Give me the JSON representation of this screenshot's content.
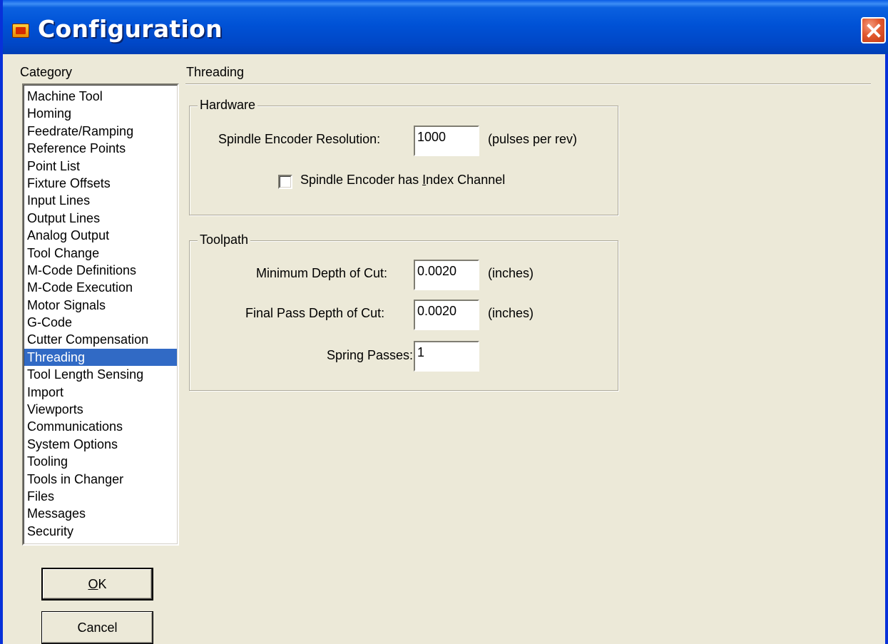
{
  "window": {
    "title": "Configuration",
    "app_icon": "app-logo-icon",
    "close_icon": "close-icon"
  },
  "colors": {
    "titlebar": "#0052d6",
    "selection": "#316ac5",
    "dialog_bg": "#ece9d8",
    "close_button": "#e25a30"
  },
  "category": {
    "label": "Category",
    "selected": "Threading",
    "items": [
      "Machine Tool",
      "Homing",
      "Feedrate/Ramping",
      "Reference Points",
      "Point List",
      "Fixture Offsets",
      "Input Lines",
      "Output Lines",
      "Analog Output",
      "Tool Change",
      "M-Code Definitions",
      "M-Code Execution",
      "Motor Signals",
      "G-Code",
      "Cutter Compensation",
      "Threading",
      "Tool Length Sensing",
      "Import",
      "Viewports",
      "Communications",
      "System Options",
      "Tooling",
      "Tools in Changer",
      "Files",
      "Messages",
      "Security"
    ]
  },
  "buttons": {
    "ok_mnemonic": "O",
    "ok_rest": "K",
    "cancel": "Cancel"
  },
  "panel": {
    "title": "Threading",
    "hardware": {
      "caption": "Hardware",
      "resolution_label": "Spindle Encoder Resolution:",
      "resolution_value": "1000",
      "resolution_unit": "(pulses per rev)",
      "index_checkbox_pre": "Spindle Encoder has ",
      "index_checkbox_mnemonic": "I",
      "index_checkbox_post": "ndex Channel",
      "index_checked": false
    },
    "toolpath": {
      "caption": "Toolpath",
      "min_depth_label": "Minimum Depth of Cut:",
      "min_depth_value": "0.0020",
      "min_depth_unit": "(inches)",
      "final_depth_label": "Final Pass Depth of Cut:",
      "final_depth_value": "0.0020",
      "final_depth_unit": "(inches)",
      "spring_label": "Spring Passes:",
      "spring_value": "1"
    }
  }
}
